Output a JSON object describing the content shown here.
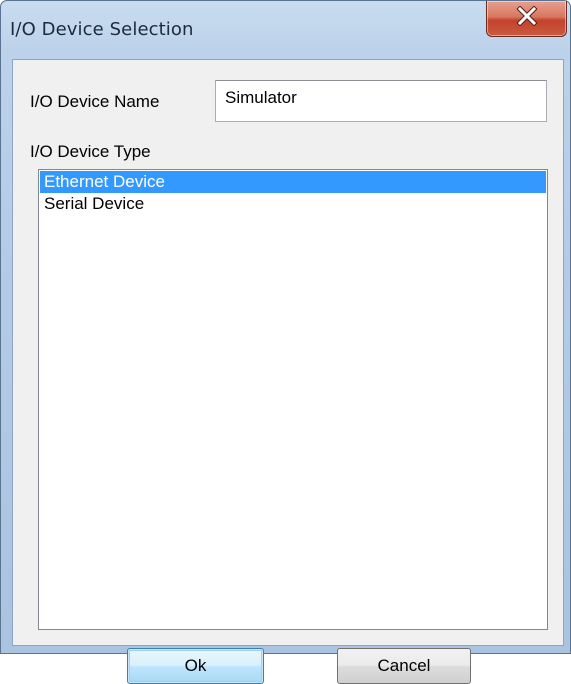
{
  "window": {
    "title": "I/O Device Selection"
  },
  "form": {
    "name_label": "I/O Device Name",
    "name_value": "Simulator",
    "type_label": "I/O Device Type",
    "device_types": [
      {
        "label": "Ethernet Device",
        "selected": true
      },
      {
        "label": "Serial Device",
        "selected": false
      }
    ]
  },
  "buttons": {
    "ok_label": "Ok",
    "cancel_label": "Cancel"
  },
  "colors": {
    "selection": "#3399ff",
    "close_button": "#c4432d"
  },
  "icons": {
    "close": "close-x-icon"
  }
}
